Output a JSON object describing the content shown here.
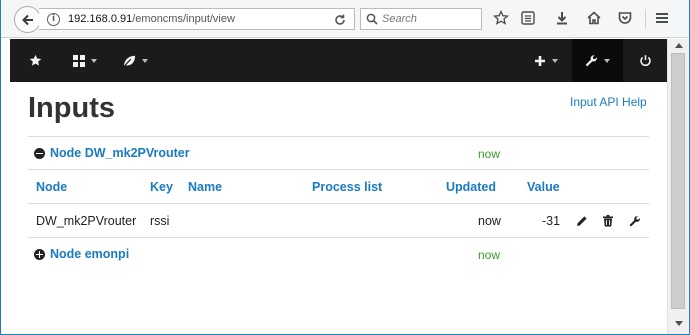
{
  "browser": {
    "url_host": "192.168.0.91",
    "url_path": "/emoncms/input/view",
    "search_placeholder": "Search",
    "info_glyph": "i"
  },
  "navbar": {
    "items": [
      "star-icon",
      "grid-icon",
      "leaf-icon",
      "plus-icon",
      "wrench-icon",
      "power-icon"
    ]
  },
  "page": {
    "title": "Inputs",
    "api_help": "Input API Help"
  },
  "nodes": [
    {
      "label": "Node DW_mk2PVrouter",
      "updated": "now",
      "expanded": true
    },
    {
      "label": "Node emonpi",
      "updated": "now",
      "expanded": false
    }
  ],
  "table": {
    "headers": {
      "node": "Node",
      "key": "Key",
      "name": "Name",
      "process": "Process list",
      "updated": "Updated",
      "value": "Value"
    },
    "rows": [
      {
        "node": "DW_mk2PVrouter",
        "key": "rssi",
        "name": "",
        "process": "",
        "updated": "now",
        "value": "-31"
      }
    ]
  },
  "colors": {
    "link": "#1a7bbf",
    "now": "#3c9e2a",
    "navbar": "#1b1b1b",
    "frame_border": "#1d7fc4"
  }
}
